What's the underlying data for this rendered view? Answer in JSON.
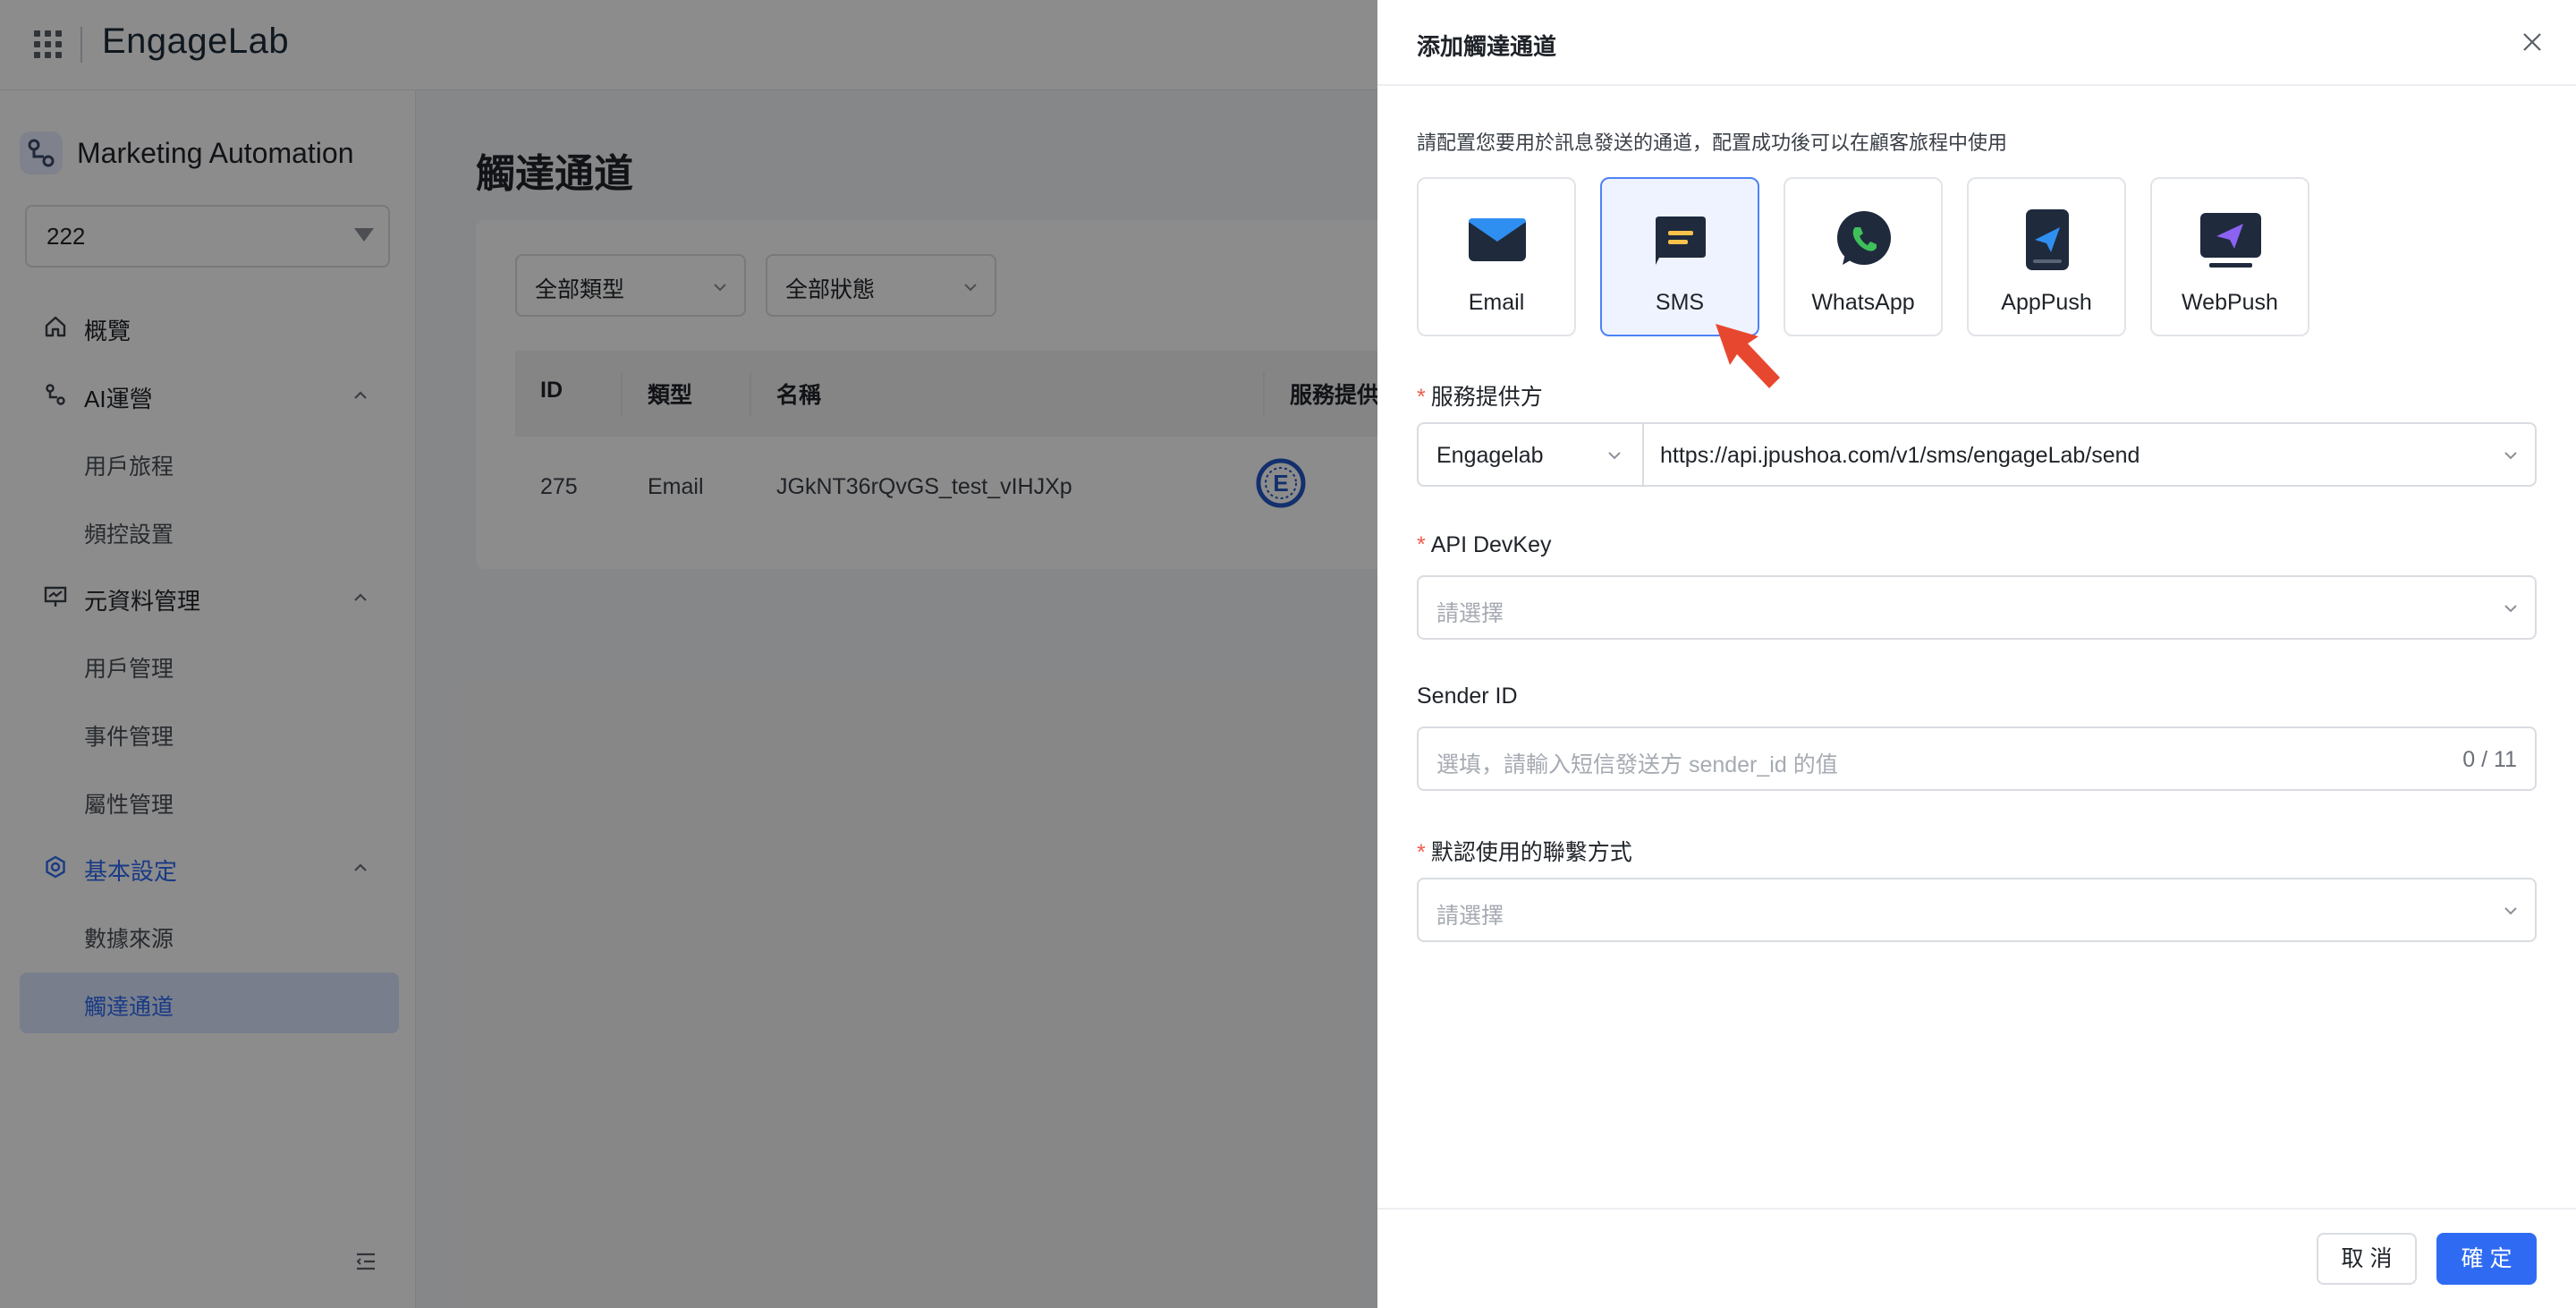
{
  "topbar": {
    "logo": "EngageLab"
  },
  "sidebar": {
    "app_title": "Marketing Automation",
    "project": "222",
    "items": [
      {
        "label": "概覽"
      },
      {
        "label": "AI運營"
      },
      {
        "label": "用戶旅程"
      },
      {
        "label": "頻控設置"
      },
      {
        "label": "元資料管理"
      },
      {
        "label": "用戶管理"
      },
      {
        "label": "事件管理"
      },
      {
        "label": "屬性管理"
      },
      {
        "label": "基本設定"
      },
      {
        "label": "數據來源"
      },
      {
        "label": "觸達通道"
      }
    ]
  },
  "main": {
    "title": "觸達通道",
    "filters": {
      "type": "全部類型",
      "status": "全部狀態"
    },
    "table": {
      "columns": [
        "ID",
        "類型",
        "名稱",
        "服務提供商"
      ],
      "rows": [
        {
          "id": "275",
          "type": "Email",
          "name": "JGkNT36rQvGS_test_vIHJXp"
        }
      ]
    }
  },
  "drawer": {
    "title": "添加觸達通道",
    "description": "請配置您要用於訊息發送的通道，配置成功後可以在顧客旅程中使用",
    "channels": [
      {
        "label": "Email",
        "icon": "email-icon"
      },
      {
        "label": "SMS",
        "icon": "sms-icon",
        "selected": true
      },
      {
        "label": "WhatsApp",
        "icon": "whatsapp-icon"
      },
      {
        "label": "AppPush",
        "icon": "apppush-icon"
      },
      {
        "label": "WebPush",
        "icon": "webpush-icon"
      }
    ],
    "provider": {
      "label": "服務提供方",
      "required": "*",
      "value": "Engagelab",
      "url": "https://api.jpushoa.com/v1/sms/engageLab/send"
    },
    "devkey": {
      "label": "API DevKey",
      "required": "*",
      "placeholder": "請選擇"
    },
    "sender": {
      "label": "Sender ID",
      "placeholder": "選填，請輸入短信發送方 sender_id 的值",
      "counter": "0 / 11"
    },
    "contact": {
      "label": "默認使用的聯繫方式",
      "required": "*",
      "placeholder": "請選擇"
    },
    "buttons": {
      "cancel": "取 消",
      "ok": "確 定"
    }
  },
  "colors": {
    "primary": "#2f6bf2",
    "selected_bg": "#eef3ff",
    "required": "#f05a4a",
    "pointer": "#e8472f"
  }
}
